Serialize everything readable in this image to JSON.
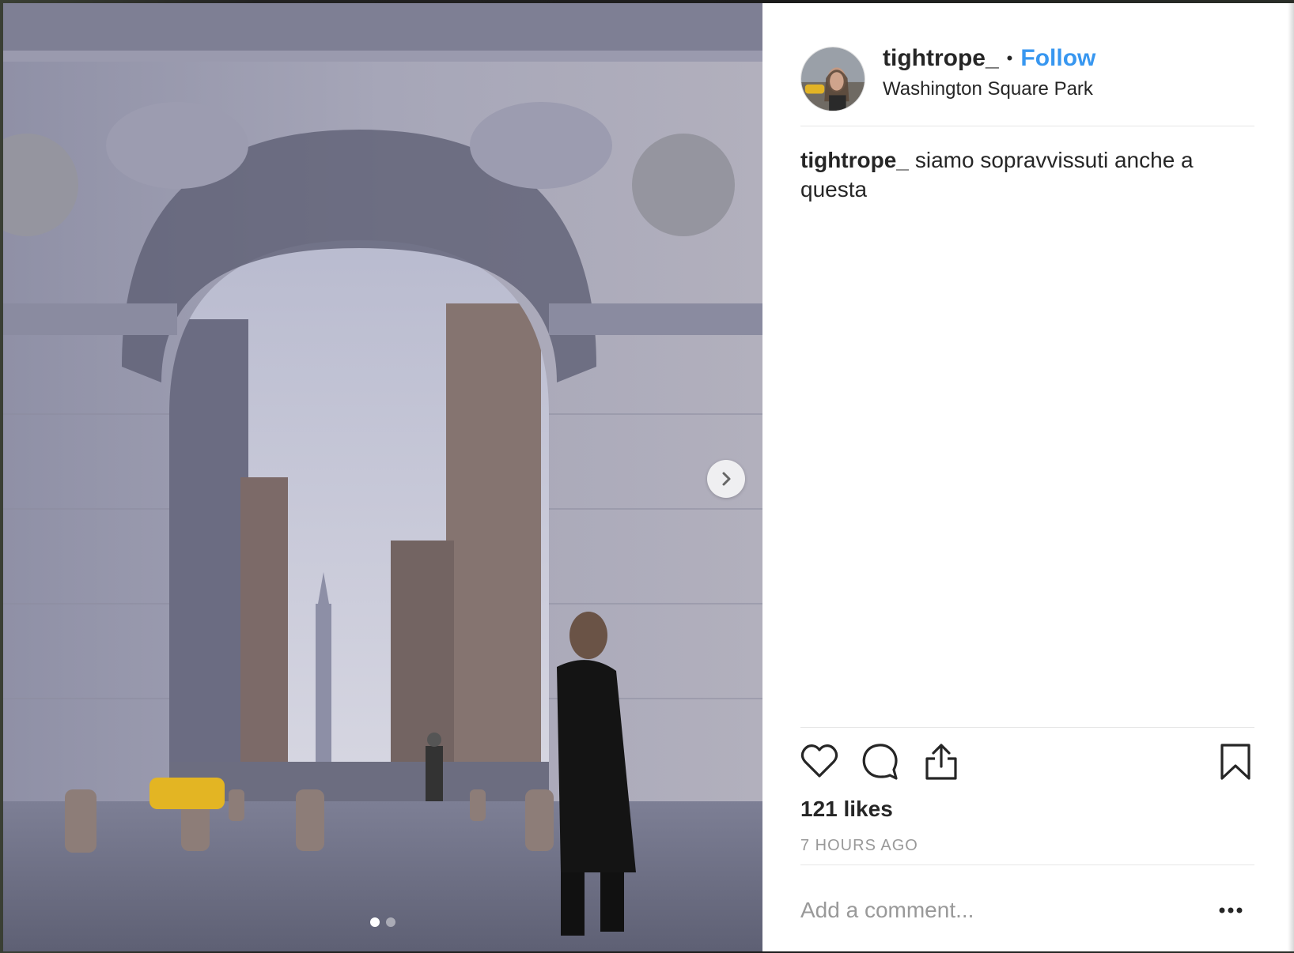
{
  "post": {
    "username": "tightrope_",
    "separator": "•",
    "follow_label": "Follow",
    "location": "Washington Square Park",
    "caption_user": "tightrope_",
    "caption_text": "siamo sopravvissuti anche a questa",
    "likes": "121 likes",
    "time_ago": "7 HOURS AGO",
    "comment_placeholder": "Add a comment...",
    "carousel": {
      "total": 2,
      "current": 1
    }
  },
  "colors": {
    "follow": "#3897f0",
    "text": "#262626",
    "muted": "#999999"
  },
  "icons": [
    "heart-icon",
    "comment-icon",
    "share-icon",
    "bookmark-icon",
    "chevron-right-icon",
    "more-icon"
  ]
}
